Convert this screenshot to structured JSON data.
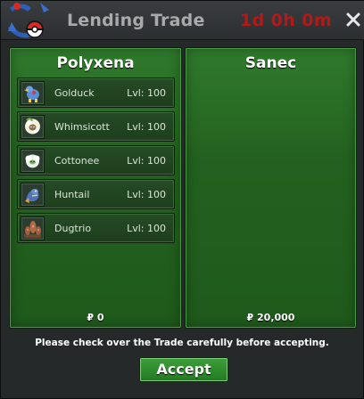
{
  "window": {
    "title": "Lending Trade",
    "timer": "1d 0h 0m",
    "accent_color": "#b01a18"
  },
  "left_panel": {
    "trainer_name": "Polyxena",
    "money": "₽ 0",
    "pokemon": [
      {
        "name": "Golduck",
        "level": "Lvl: 100",
        "icon": "golduck-sprite-icon"
      },
      {
        "name": "Whimsicott",
        "level": "Lvl: 100",
        "icon": "whimsicott-sprite-icon"
      },
      {
        "name": "Cottonee",
        "level": "Lvl: 100",
        "icon": "cottonee-sprite-icon"
      },
      {
        "name": "Huntail",
        "level": "Lvl: 100",
        "icon": "huntail-sprite-icon"
      },
      {
        "name": "Dugtrio",
        "level": "Lvl: 100",
        "icon": "dugtrio-sprite-icon"
      }
    ]
  },
  "right_panel": {
    "trainer_name": "Sanec",
    "money": "₽ 20,000",
    "pokemon": []
  },
  "footer": {
    "notice": "Please check over the Trade carefully before accepting.",
    "accept_label": "Accept"
  },
  "icons": {
    "logo": "pokeball-trade-logo-icon",
    "close": "close-icon"
  }
}
